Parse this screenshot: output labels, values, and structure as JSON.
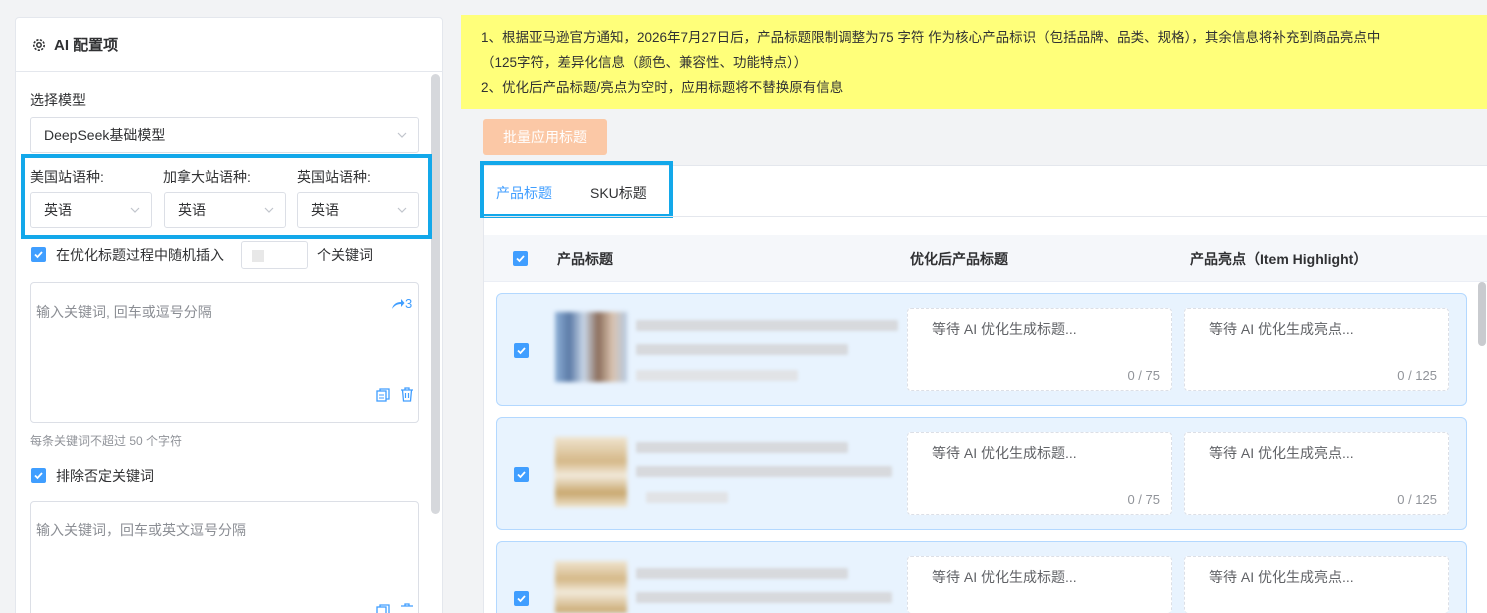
{
  "config_panel": {
    "title": "AI 配置项",
    "model_label": "选择模型",
    "model_value": "DeepSeek基础模型",
    "us_lang_label": "美国站语种:",
    "ca_lang_label": "加拿大站语种:",
    "uk_lang_label": "英国站语种:",
    "us_lang_value": "英语",
    "ca_lang_value": "英语",
    "uk_lang_value": "英语",
    "insert_keywords_label": "在优化标题过程中随机插入",
    "insert_keywords_suffix": "个关键词",
    "insert_keywords_checked": true,
    "keywords_placeholder": "输入关键词, 回车或逗号分隔",
    "keywords_share_count": "3",
    "keywords_hint": "每条关键词不超过 50 个字符",
    "exclude_negative_label": "排除否定关键词",
    "exclude_negative_checked": true,
    "negative_placeholder": "输入关键词，回车或英文逗号分隔"
  },
  "notice": {
    "line1": "1、根据亚马逊官方通知，2026年7月27日后，产品标题限制调整为75 字符 作为核心产品标识（包括品牌、品类、规格），其余信息将补充到商品亮点中",
    "line2": "（125字符，差异化信息（颜色、兼容性、功能特点））",
    "line3": "2、优化后产品标题/亮点为空时，应用标题将不替换原有信息",
    "background": "#ffff7a"
  },
  "toolbar": {
    "batch_apply_label": "批量应用标题"
  },
  "tabs": [
    {
      "label": "产品标题",
      "active": true
    },
    {
      "label": "SKU标题",
      "active": false
    }
  ],
  "table": {
    "columns": [
      "产品标题",
      "优化后产品标题",
      "产品亮点（Item Highlight）"
    ],
    "rows": [
      {
        "checked": true,
        "title_placeholder": "等待 AI 优化生成标题...",
        "title_count": "0 / 75",
        "highlight_placeholder": "等待 AI 优化生成亮点...",
        "highlight_count": "0 / 125"
      },
      {
        "checked": true,
        "title_placeholder": "等待 AI 优化生成标题...",
        "title_count": "0 / 75",
        "highlight_placeholder": "等待 AI 优化生成亮点...",
        "highlight_count": "0 / 125"
      },
      {
        "checked": true,
        "title_placeholder": "等待 AI 优化生成标题...",
        "title_count": "",
        "highlight_placeholder": "等待 AI 优化生成亮点...",
        "highlight_count": ""
      }
    ]
  },
  "colors": {
    "primary": "#409eff",
    "highlight_border": "#13a8ea",
    "batch_button_disabled": "#fbc8a6",
    "row_selected_bg": "#e8f3fe"
  }
}
